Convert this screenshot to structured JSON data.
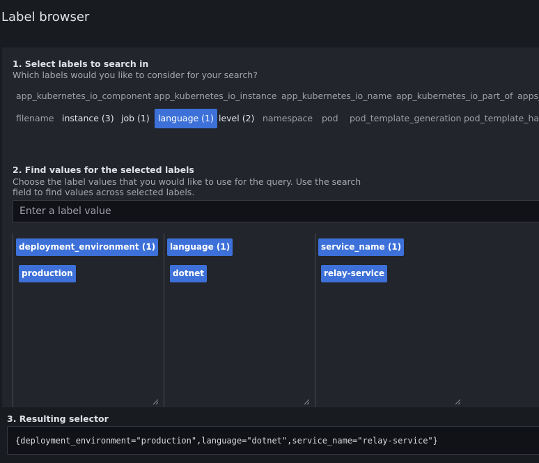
{
  "title": "Label browser",
  "step1": {
    "heading": "1. Select labels to search in",
    "subtitle": "Which labels would you like to consider for your search?",
    "row1": [
      "app_kubernetes_io_component",
      "app_kubernetes_io_instance",
      "app_kubernetes_io_name",
      "app_kubernetes_io_part_of",
      "apps_"
    ],
    "row2": [
      "filename",
      "instance (3)",
      "job (1)",
      "language (1)",
      "level (2)",
      "namespace",
      "pod",
      "pod_template_generation",
      "pod_template_hash"
    ]
  },
  "step2": {
    "heading": "2. Find values for the selected labels",
    "subtitle_line1": "Choose the label values that you would like to use for the query. Use the search",
    "subtitle_line2": "field to find values across selected labels.",
    "search_placeholder": "Enter a label value",
    "columns": [
      {
        "label": "deployment_environment (1)",
        "value": "production"
      },
      {
        "label": "language (1)",
        "value": "dotnet"
      },
      {
        "label": "service_name (1)",
        "value": "relay-service"
      }
    ]
  },
  "step3": {
    "heading": "3. Resulting selector",
    "selector": "{deployment_environment=\"production\",language=\"dotnet\",service_name=\"relay-service\"}"
  },
  "colors": {
    "accent": "#3d71d9",
    "background": "#181b1f",
    "panel": "#22252b"
  },
  "state": {
    "selected_label": "language (1)",
    "labels_with_counts": [
      "instance (3)",
      "job (1)",
      "language (1)",
      "level (2)"
    ]
  }
}
